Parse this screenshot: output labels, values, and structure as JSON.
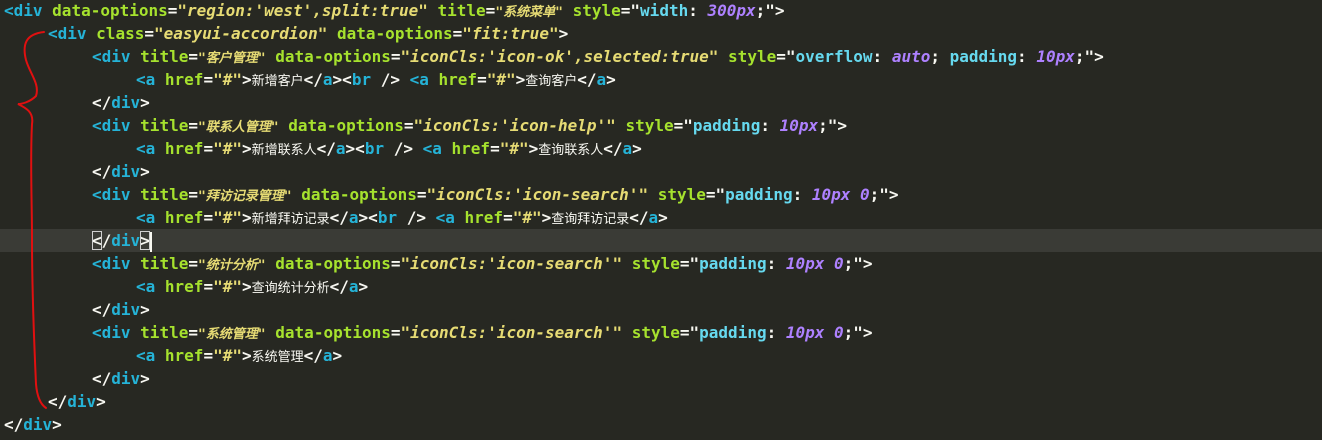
{
  "lines": [
    {
      "indent": 0,
      "tokens": [
        {
          "t": "<div",
          "c": "tag"
        },
        {
          "t": " "
        },
        {
          "t": "data-options",
          "c": "attr"
        },
        {
          "t": "=",
          "c": "txt0"
        },
        {
          "t": "\"region:'west',split:true\"",
          "c": "str"
        },
        {
          "t": " "
        },
        {
          "t": "title",
          "c": "attr"
        },
        {
          "t": "="
        },
        {
          "t": "\"系统菜单\"",
          "c": "str zh"
        },
        {
          "t": " "
        },
        {
          "t": "style",
          "c": "attr"
        },
        {
          "t": "=\""
        },
        {
          "t": "width",
          "c": "css"
        },
        {
          "t": ": "
        },
        {
          "t": "300px",
          "c": "num"
        },
        {
          "t": ";\">"
        }
      ]
    },
    {
      "indent": 1,
      "tokens": [
        {
          "t": "<div",
          "c": "tag"
        },
        {
          "t": " "
        },
        {
          "t": "class",
          "c": "attr"
        },
        {
          "t": "="
        },
        {
          "t": "\"easyui-accordion\"",
          "c": "cls"
        },
        {
          "t": " "
        },
        {
          "t": "data-options",
          "c": "attr"
        },
        {
          "t": "="
        },
        {
          "t": "\"fit:true\"",
          "c": "str"
        },
        {
          "t": ">"
        }
      ]
    },
    {
      "indent": 2,
      "tokens": [
        {
          "t": "<div",
          "c": "tag"
        },
        {
          "t": " "
        },
        {
          "t": "title",
          "c": "attr"
        },
        {
          "t": "="
        },
        {
          "t": "\"客户管理\"",
          "c": "str zh"
        },
        {
          "t": " "
        },
        {
          "t": "data-options",
          "c": "attr"
        },
        {
          "t": "="
        },
        {
          "t": "\"iconCls:'icon-ok',selected:true\"",
          "c": "str"
        },
        {
          "t": " "
        },
        {
          "t": "style",
          "c": "attr"
        },
        {
          "t": "=\""
        },
        {
          "t": "overflow",
          "c": "css"
        },
        {
          "t": ": "
        },
        {
          "t": "auto",
          "c": "num"
        },
        {
          "t": "; "
        },
        {
          "t": "padding",
          "c": "css"
        },
        {
          "t": ": "
        },
        {
          "t": "10px",
          "c": "num"
        },
        {
          "t": ";\">"
        }
      ]
    },
    {
      "indent": 3,
      "tokens": [
        {
          "t": "<a",
          "c": "tag"
        },
        {
          "t": " "
        },
        {
          "t": "href",
          "c": "attr"
        },
        {
          "t": "="
        },
        {
          "t": "\"#\"",
          "c": "str"
        },
        {
          "t": ">"
        },
        {
          "t": "新增客户",
          "c": "txt zh"
        },
        {
          "t": "</"
        },
        {
          "t": "a",
          "c": "tag"
        },
        {
          "t": "><"
        },
        {
          "t": "br",
          "c": "tag"
        },
        {
          "t": " />"
        },
        {
          "t": " "
        },
        {
          "t": "<a",
          "c": "tag"
        },
        {
          "t": " "
        },
        {
          "t": "href",
          "c": "attr"
        },
        {
          "t": "="
        },
        {
          "t": "\"#\"",
          "c": "str"
        },
        {
          "t": ">"
        },
        {
          "t": "查询客户",
          "c": "txt zh"
        },
        {
          "t": "</"
        },
        {
          "t": "a",
          "c": "tag"
        },
        {
          "t": ">"
        }
      ]
    },
    {
      "indent": 2,
      "tokens": [
        {
          "t": "</"
        },
        {
          "t": "div",
          "c": "tag"
        },
        {
          "t": ">"
        }
      ]
    },
    {
      "indent": 2,
      "tokens": [
        {
          "t": "<div",
          "c": "tag"
        },
        {
          "t": " "
        },
        {
          "t": "title",
          "c": "attr"
        },
        {
          "t": "="
        },
        {
          "t": "\"联系人管理\"",
          "c": "str zh"
        },
        {
          "t": " "
        },
        {
          "t": "data-options",
          "c": "attr"
        },
        {
          "t": "="
        },
        {
          "t": "\"iconCls:'icon-help'\"",
          "c": "str"
        },
        {
          "t": " "
        },
        {
          "t": "style",
          "c": "attr"
        },
        {
          "t": "=\""
        },
        {
          "t": "padding",
          "c": "css"
        },
        {
          "t": ": "
        },
        {
          "t": "10px",
          "c": "num"
        },
        {
          "t": ";\">"
        }
      ]
    },
    {
      "indent": 3,
      "tokens": [
        {
          "t": "<a",
          "c": "tag"
        },
        {
          "t": " "
        },
        {
          "t": "href",
          "c": "attr"
        },
        {
          "t": "="
        },
        {
          "t": "\"#\"",
          "c": "str"
        },
        {
          "t": ">"
        },
        {
          "t": "新增联系人",
          "c": "txt zh"
        },
        {
          "t": "</"
        },
        {
          "t": "a",
          "c": "tag"
        },
        {
          "t": "><"
        },
        {
          "t": "br",
          "c": "tag"
        },
        {
          "t": " />"
        },
        {
          "t": " "
        },
        {
          "t": "<a",
          "c": "tag"
        },
        {
          "t": " "
        },
        {
          "t": "href",
          "c": "attr"
        },
        {
          "t": "="
        },
        {
          "t": "\"#\"",
          "c": "str"
        },
        {
          "t": ">"
        },
        {
          "t": "查询联系人",
          "c": "txt zh"
        },
        {
          "t": "</"
        },
        {
          "t": "a",
          "c": "tag"
        },
        {
          "t": ">"
        }
      ]
    },
    {
      "indent": 2,
      "tokens": [
        {
          "t": "</"
        },
        {
          "t": "div",
          "c": "tag"
        },
        {
          "t": ">"
        }
      ]
    },
    {
      "indent": 2,
      "tokens": [
        {
          "t": "<div",
          "c": "tag"
        },
        {
          "t": " "
        },
        {
          "t": "title",
          "c": "attr"
        },
        {
          "t": "="
        },
        {
          "t": "\"拜访记录管理\"",
          "c": "str zh"
        },
        {
          "t": " "
        },
        {
          "t": "data-options",
          "c": "attr"
        },
        {
          "t": "="
        },
        {
          "t": "\"iconCls:'icon-search'\"",
          "c": "str"
        },
        {
          "t": " "
        },
        {
          "t": "style",
          "c": "attr"
        },
        {
          "t": "=\""
        },
        {
          "t": "padding",
          "c": "css"
        },
        {
          "t": ": "
        },
        {
          "t": "10px 0",
          "c": "num"
        },
        {
          "t": ";\">"
        }
      ]
    },
    {
      "indent": 3,
      "tokens": [
        {
          "t": "<a",
          "c": "tag"
        },
        {
          "t": " "
        },
        {
          "t": "href",
          "c": "attr"
        },
        {
          "t": "="
        },
        {
          "t": "\"#\"",
          "c": "str"
        },
        {
          "t": ">"
        },
        {
          "t": "新增拜访记录",
          "c": "txt zh"
        },
        {
          "t": "</"
        },
        {
          "t": "a",
          "c": "tag"
        },
        {
          "t": "><"
        },
        {
          "t": "br",
          "c": "tag"
        },
        {
          "t": " />"
        },
        {
          "t": " "
        },
        {
          "t": "<a",
          "c": "tag"
        },
        {
          "t": " "
        },
        {
          "t": "href",
          "c": "attr"
        },
        {
          "t": "="
        },
        {
          "t": "\"#\"",
          "c": "str"
        },
        {
          "t": ">"
        },
        {
          "t": "查询拜访记录",
          "c": "txt zh"
        },
        {
          "t": "</"
        },
        {
          "t": "a",
          "c": "tag"
        },
        {
          "t": ">"
        }
      ]
    },
    {
      "indent": 2,
      "current": true,
      "tokens": [
        {
          "t": "<",
          "c": "bracket-hl"
        },
        {
          "t": "/"
        },
        {
          "t": "div",
          "c": "tag"
        },
        {
          "t": ">",
          "c": "bracket-hl"
        }
      ]
    },
    {
      "indent": 2,
      "tokens": [
        {
          "t": "<div",
          "c": "tag"
        },
        {
          "t": " "
        },
        {
          "t": "title",
          "c": "attr"
        },
        {
          "t": "="
        },
        {
          "t": "\"统计分析\"",
          "c": "str zh"
        },
        {
          "t": " "
        },
        {
          "t": "data-options",
          "c": "attr"
        },
        {
          "t": "="
        },
        {
          "t": "\"iconCls:'icon-search'\"",
          "c": "str"
        },
        {
          "t": " "
        },
        {
          "t": "style",
          "c": "attr"
        },
        {
          "t": "=\""
        },
        {
          "t": "padding",
          "c": "css"
        },
        {
          "t": ": "
        },
        {
          "t": "10px 0",
          "c": "num"
        },
        {
          "t": ";\">"
        }
      ]
    },
    {
      "indent": 3,
      "tokens": [
        {
          "t": "<a",
          "c": "tag"
        },
        {
          "t": " "
        },
        {
          "t": "href",
          "c": "attr"
        },
        {
          "t": "="
        },
        {
          "t": "\"#\"",
          "c": "str"
        },
        {
          "t": ">"
        },
        {
          "t": "查询统计分析",
          "c": "txt zh"
        },
        {
          "t": "</"
        },
        {
          "t": "a",
          "c": "tag"
        },
        {
          "t": ">"
        }
      ]
    },
    {
      "indent": 2,
      "tokens": [
        {
          "t": "</"
        },
        {
          "t": "div",
          "c": "tag"
        },
        {
          "t": ">"
        }
      ]
    },
    {
      "indent": 2,
      "tokens": [
        {
          "t": "<div",
          "c": "tag"
        },
        {
          "t": " "
        },
        {
          "t": "title",
          "c": "attr"
        },
        {
          "t": "="
        },
        {
          "t": "\"系统管理\"",
          "c": "str zh"
        },
        {
          "t": " "
        },
        {
          "t": "data-options",
          "c": "attr"
        },
        {
          "t": "="
        },
        {
          "t": "\"iconCls:'icon-search'\"",
          "c": "str"
        },
        {
          "t": " "
        },
        {
          "t": "style",
          "c": "attr"
        },
        {
          "t": "=\""
        },
        {
          "t": "padding",
          "c": "css"
        },
        {
          "t": ": "
        },
        {
          "t": "10px 0",
          "c": "num"
        },
        {
          "t": ";\">"
        }
      ]
    },
    {
      "indent": 3,
      "tokens": [
        {
          "t": "<a",
          "c": "tag"
        },
        {
          "t": " "
        },
        {
          "t": "href",
          "c": "attr"
        },
        {
          "t": "="
        },
        {
          "t": "\"#\"",
          "c": "str"
        },
        {
          "t": ">"
        },
        {
          "t": "系统管理",
          "c": "txt zh"
        },
        {
          "t": "</"
        },
        {
          "t": "a",
          "c": "tag"
        },
        {
          "t": ">"
        }
      ]
    },
    {
      "indent": 2,
      "tokens": [
        {
          "t": "</"
        },
        {
          "t": "div",
          "c": "tag"
        },
        {
          "t": ">"
        }
      ]
    },
    {
      "indent": 1,
      "tokens": [
        {
          "t": "</"
        },
        {
          "t": "div",
          "c": "tag"
        },
        {
          "t": ">"
        }
      ]
    },
    {
      "indent": 0,
      "tokens": [
        {
          "t": "</"
        },
        {
          "t": "div",
          "c": "tag"
        },
        {
          "t": ">"
        }
      ]
    }
  ],
  "colors": {
    "background": "#272822",
    "current_line": "#3a3b36",
    "tag": "#25b3d7",
    "attribute": "#a6e22e",
    "string": "#e6db74",
    "css_property": "#66d9ef",
    "number": "#ae81ff",
    "text": "#f8f8f2",
    "annotation": "#e01010"
  }
}
